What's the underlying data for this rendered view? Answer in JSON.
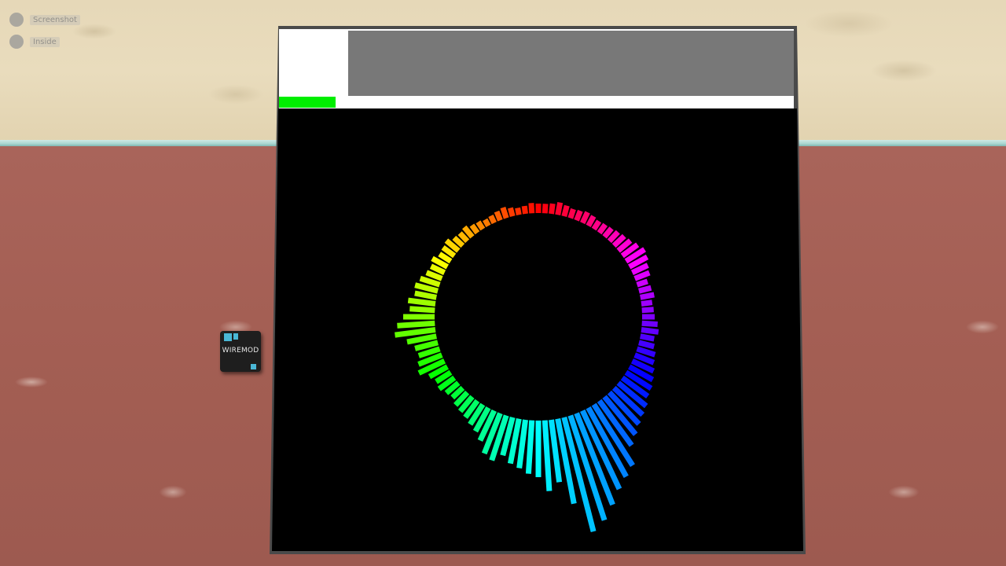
{
  "hud": {
    "items": [
      {
        "label": "Screenshot"
      },
      {
        "label": "Inside"
      }
    ]
  },
  "chip": {
    "label": "WIREMOD"
  },
  "screen": {
    "progress": 0.11
  },
  "visualizer": {
    "type": "radial-spectrum",
    "bar_count": 100,
    "start_hue_degrees": 0,
    "hue_direction": "counter-clockwise",
    "bar_lengths": [
      12,
      13,
      10,
      9,
      11,
      14,
      12,
      10,
      9,
      11,
      12,
      16,
      14,
      15,
      20,
      18,
      17,
      22,
      19,
      21,
      26,
      30,
      28,
      35,
      32,
      40,
      48,
      52,
      38,
      30,
      28,
      32,
      36,
      26,
      22,
      24,
      20,
      18,
      22,
      24,
      26,
      30,
      34,
      42,
      55,
      60,
      50,
      58,
      62,
      68,
      72,
      90,
      80,
      110,
      150,
      140,
      125,
      110,
      100,
      92,
      70,
      62,
      55,
      50,
      46,
      40,
      38,
      34,
      30,
      26,
      24,
      20,
      18,
      22,
      20,
      16,
      15,
      14,
      18,
      16,
      14,
      20,
      22,
      26,
      28,
      24,
      20,
      18,
      16,
      14,
      13,
      12,
      14,
      15,
      13,
      12,
      14,
      16,
      13,
      12
    ]
  }
}
